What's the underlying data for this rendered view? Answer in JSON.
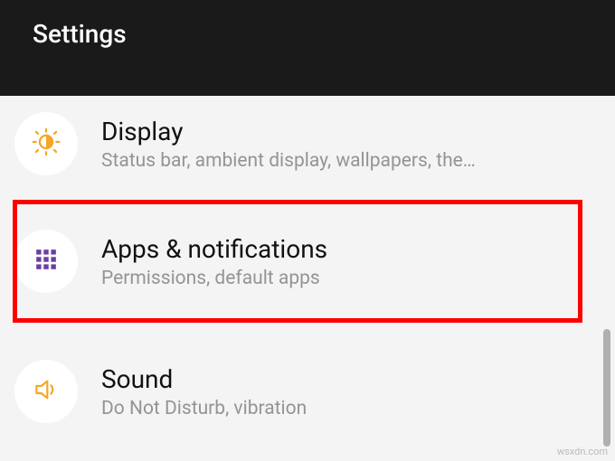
{
  "header": {
    "title": "Settings"
  },
  "items": [
    {
      "key": "display",
      "title": "Display",
      "subtitle": "Status bar, ambient display, wallpapers, the…",
      "icon": "sun-icon",
      "highlighted": false
    },
    {
      "key": "apps",
      "title": "Apps & notifications",
      "subtitle": "Permissions, default apps",
      "icon": "grid-icon",
      "highlighted": true
    },
    {
      "key": "sound",
      "title": "Sound",
      "subtitle": "Do Not Disturb, vibration",
      "icon": "speaker-icon",
      "highlighted": false
    }
  ],
  "watermark": "wsxdn.com",
  "colors": {
    "header_bg": "#1a1a1a",
    "display_icon": "#f5a623",
    "apps_icon": "#6b3fa0",
    "sound_icon": "#f5a623",
    "highlight_border": "#ff0000"
  }
}
